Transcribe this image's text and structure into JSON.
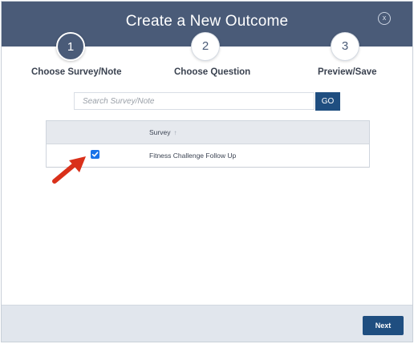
{
  "modal": {
    "title": "Create a New Outcome",
    "close_label": "x"
  },
  "steps": [
    {
      "number": "1",
      "label": "Choose Survey/Note",
      "state": "active"
    },
    {
      "number": "2",
      "label": "Choose Question",
      "state": "inactive"
    },
    {
      "number": "3",
      "label": "Preview/Save",
      "state": "inactive"
    }
  ],
  "search": {
    "placeholder": "Search Survey/Note",
    "value": "",
    "go_label": "GO"
  },
  "table": {
    "columns": [
      "",
      "Survey"
    ],
    "sort_indicator": "↑",
    "rows": [
      {
        "checked": true,
        "survey": "Fitness Challenge Follow Up"
      }
    ]
  },
  "footer": {
    "next_label": "Next"
  },
  "colors": {
    "header_bg": "#4a5b78",
    "primary_button": "#1f4e80",
    "checkbox": "#1a73e8",
    "annotation_arrow": "#d9301a",
    "footer_bg": "#e1e6ed"
  }
}
